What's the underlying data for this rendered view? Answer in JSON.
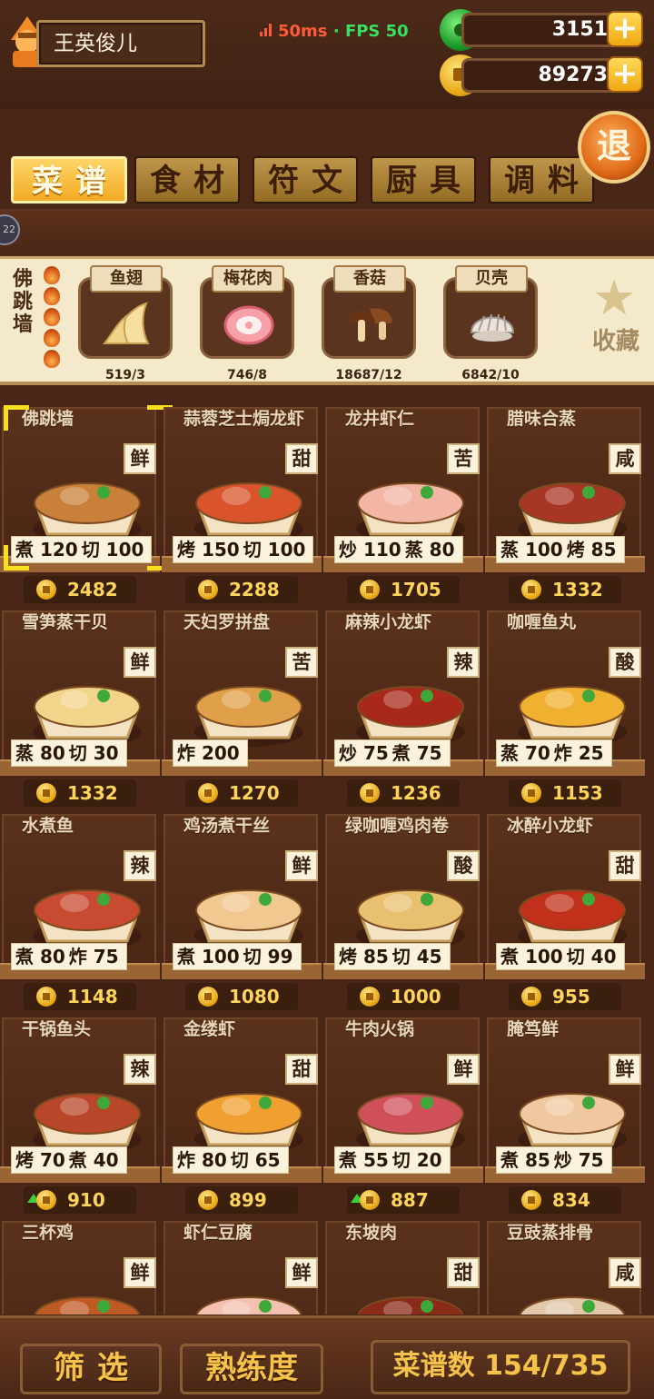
{
  "player": {
    "name": "王英俊儿"
  },
  "network": {
    "ping": "50ms",
    "separator": "·",
    "fps": "FPS 50"
  },
  "currency": {
    "jade": "3151",
    "coins": "89273"
  },
  "exit_label": "退",
  "tabs": [
    {
      "label": "菜谱",
      "active": true
    },
    {
      "label": "食材",
      "active": false
    },
    {
      "label": "符文",
      "active": false
    },
    {
      "label": "厨具",
      "active": false
    },
    {
      "label": "调料",
      "active": false
    }
  ],
  "level_badge": "22",
  "selected_recipe": {
    "name": "佛跳墙",
    "star_count": 5,
    "ingredients": [
      {
        "name": "鱼翅",
        "count": "519/3",
        "icon": "shark-fin-icon"
      },
      {
        "name": "梅花肉",
        "count": "746/8",
        "icon": "pork-icon"
      },
      {
        "name": "香菇",
        "count": "18687/12",
        "icon": "mushroom-icon"
      },
      {
        "name": "贝壳",
        "count": "6842/10",
        "icon": "shell-icon"
      }
    ],
    "favorite_label": "收藏"
  },
  "recipes": [
    {
      "name": "佛跳墙",
      "flavor": "鲜",
      "skills": [
        "煮 120",
        "切 100"
      ],
      "price": "2482",
      "selected": true,
      "boosted": false,
      "color": "#c9803a"
    },
    {
      "name": "蒜蓉芝士焗龙虾",
      "flavor": "甜",
      "skills": [
        "烤 150",
        "切 100"
      ],
      "price": "2288",
      "selected": false,
      "boosted": false,
      "color": "#d9542a"
    },
    {
      "name": "龙井虾仁",
      "flavor": "苦",
      "skills": [
        "炒 110",
        "蒸 80"
      ],
      "price": "1705",
      "selected": false,
      "boosted": false,
      "color": "#f3b6a4"
    },
    {
      "name": "腊味合蒸",
      "flavor": "咸",
      "skills": [
        "蒸 100",
        "烤 85"
      ],
      "price": "1332",
      "selected": false,
      "boosted": false,
      "color": "#a83624"
    },
    {
      "name": "雪笋蒸干贝",
      "flavor": "鲜",
      "skills": [
        "蒸 80",
        "切 30"
      ],
      "price": "1332",
      "selected": false,
      "boosted": false,
      "color": "#f2d48a"
    },
    {
      "name": "天妇罗拼盘",
      "flavor": "苦",
      "skills": [
        "炸 200"
      ],
      "price": "1270",
      "selected": false,
      "boosted": false,
      "color": "#e0a04a"
    },
    {
      "name": "麻辣小龙虾",
      "flavor": "辣",
      "skills": [
        "炒 75",
        "煮 75"
      ],
      "price": "1236",
      "selected": false,
      "boosted": false,
      "color": "#a8281a"
    },
    {
      "name": "咖喱鱼丸",
      "flavor": "酸",
      "skills": [
        "蒸 70",
        "炸 25"
      ],
      "price": "1153",
      "selected": false,
      "boosted": false,
      "color": "#f0b030"
    },
    {
      "name": "水煮鱼",
      "flavor": "辣",
      "skills": [
        "煮 80",
        "炸 75"
      ],
      "price": "1148",
      "selected": false,
      "boosted": false,
      "color": "#c84a30"
    },
    {
      "name": "鸡汤煮干丝",
      "flavor": "鲜",
      "skills": [
        "煮 100",
        "切 99"
      ],
      "price": "1080",
      "selected": false,
      "boosted": false,
      "color": "#f0c890"
    },
    {
      "name": "绿咖喱鸡肉卷",
      "flavor": "酸",
      "skills": [
        "烤 85",
        "切 45"
      ],
      "price": "1000",
      "selected": false,
      "boosted": false,
      "color": "#e8c070"
    },
    {
      "name": "冰醉小龙虾",
      "flavor": "甜",
      "skills": [
        "煮 100",
        "切 40"
      ],
      "price": "955",
      "selected": false,
      "boosted": false,
      "color": "#c0301a"
    },
    {
      "name": "干锅鱼头",
      "flavor": "辣",
      "skills": [
        "烤 70",
        "煮 40"
      ],
      "price": "910",
      "selected": false,
      "boosted": true,
      "color": "#b84628"
    },
    {
      "name": "金缕虾",
      "flavor": "甜",
      "skills": [
        "炸 80",
        "切 65"
      ],
      "price": "899",
      "selected": false,
      "boosted": false,
      "color": "#f0a030"
    },
    {
      "name": "牛肉火锅",
      "flavor": "鲜",
      "skills": [
        "煮 55",
        "切 20"
      ],
      "price": "887",
      "selected": false,
      "boosted": true,
      "color": "#d0505a"
    },
    {
      "name": "腌笃鲜",
      "flavor": "鲜",
      "skills": [
        "煮 85",
        "炒 75"
      ],
      "price": "834",
      "selected": false,
      "boosted": false,
      "color": "#f0c8a0"
    },
    {
      "name": "三杯鸡",
      "flavor": "鲜",
      "skills": [],
      "price": "",
      "selected": false,
      "boosted": false,
      "color": "#c05a24"
    },
    {
      "name": "虾仁豆腐",
      "flavor": "鲜",
      "skills": [],
      "price": "",
      "selected": false,
      "boosted": false,
      "color": "#f4c0b0"
    },
    {
      "name": "东坡肉",
      "flavor": "甜",
      "skills": [],
      "price": "",
      "selected": false,
      "boosted": false,
      "color": "#8a2a18"
    },
    {
      "name": "豆豉蒸排骨",
      "flavor": "咸",
      "skills": [],
      "price": "",
      "selected": false,
      "boosted": false,
      "color": "#e0c8a8"
    }
  ],
  "bottom": {
    "filter_label": "筛选",
    "mastery_label": "熟练度",
    "recipe_count": "菜谱数 154/735"
  }
}
